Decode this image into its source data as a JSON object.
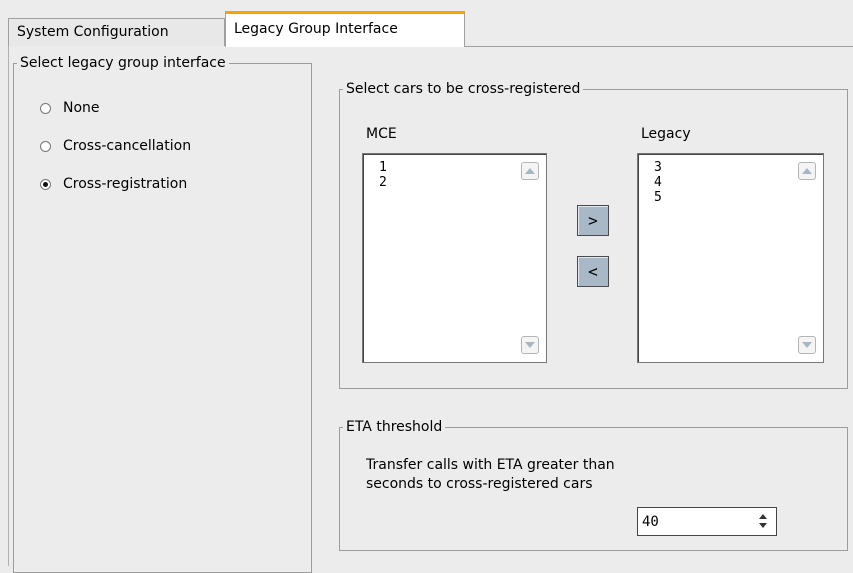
{
  "tabs": [
    {
      "label": "System Configuration"
    },
    {
      "label": "Legacy Group Interface"
    }
  ],
  "legacy_group": {
    "legend": "Select legacy group interface",
    "options": [
      {
        "label": "None",
        "checked": false
      },
      {
        "label": "Cross-cancellation",
        "checked": false
      },
      {
        "label": "Cross-registration",
        "checked": true
      }
    ]
  },
  "cross_register": {
    "legend": "Select cars to be cross-registered",
    "mce_label": "MCE",
    "mce_items": [
      "1",
      "2"
    ],
    "legacy_label": "Legacy",
    "legacy_items": [
      "3",
      "4",
      "5"
    ],
    "add_label": ">",
    "remove_label": "<"
  },
  "eta": {
    "legend": "ETA threshold",
    "text_line1": "Transfer calls with ETA greater than",
    "text_line2": "seconds to cross-registered cars",
    "value": "40"
  }
}
